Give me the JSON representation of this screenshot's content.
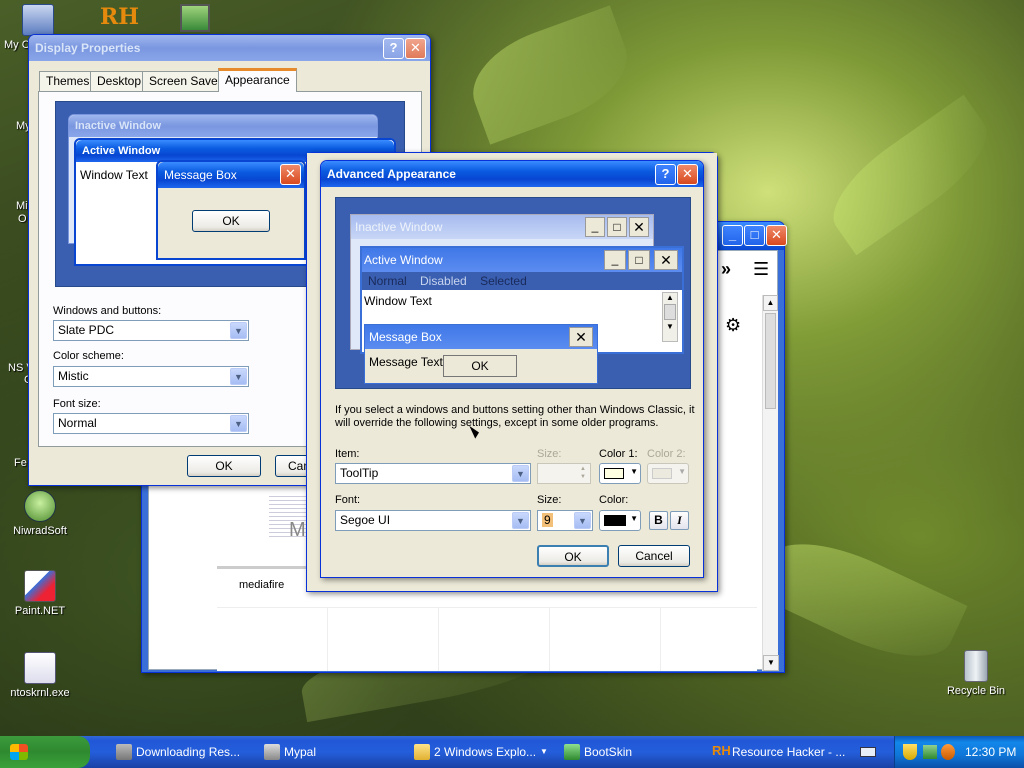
{
  "desktop_icons": [
    {
      "label": "My C",
      "icon": "my-computer-icon"
    },
    {
      "label": "NiwradSoft",
      "icon": "alien-icon"
    },
    {
      "label": "Paint.NET",
      "icon": "paint-icon"
    },
    {
      "label": "ntoskrnl.exe",
      "icon": "exe-icon"
    },
    {
      "label": "Recycle Bin",
      "icon": "recycle-bin-icon"
    }
  ],
  "desktop_partial_labels": [
    "My",
    "Mi",
    "O",
    "NS V",
    "C",
    "Fe"
  ],
  "browser_window": {
    "thumbnail_label": "mediafire",
    "thumbnail_letter": "M",
    "toolbar_chevron": "»",
    "toolbar_menu": "☰"
  },
  "display_properties": {
    "title": "Display Properties",
    "tabs": [
      "Themes",
      "Desktop",
      "Screen Saver",
      "Appearance"
    ],
    "active_tab": "Appearance",
    "preview": {
      "inactive_title": "Inactive Window",
      "active_title": "Active Window",
      "window_text": "Window Text",
      "message_box_title": "Message Box",
      "ok": "OK"
    },
    "windows_buttons_label": "Windows and buttons:",
    "windows_buttons_value": "Slate PDC",
    "color_scheme_label": "Color scheme:",
    "color_scheme_value": "Mistic",
    "font_size_label": "Font size:",
    "font_size_value": "Normal",
    "ok": "OK",
    "cancel": "Cance"
  },
  "advanced": {
    "title": "Advanced Appearance",
    "preview": {
      "inactive_title": "Inactive Window",
      "active_title": "Active Window",
      "menu_items": [
        "Normal",
        "Disabled",
        "Selected"
      ],
      "window_text": "Window Text",
      "message_box_title": "Message Box",
      "message_text": "Message Text",
      "ok": "OK"
    },
    "description": "If you select a windows and buttons setting other than Windows Classic, it will override the following settings, except in some older programs.",
    "item_label": "Item:",
    "item_value": "ToolTip",
    "size_label": "Size:",
    "color1_label": "Color 1:",
    "color2_label": "Color 2:",
    "font_label": "Font:",
    "font_value": "Segoe UI",
    "font_size_label": "Size:",
    "font_size_value": "9",
    "color_label": "Color:",
    "bold": "B",
    "italic": "I",
    "ok": "OK",
    "cancel": "Cancel",
    "color1": "#ffffe1",
    "font_color": "#000000"
  },
  "taskbar": {
    "start": "start",
    "items": [
      {
        "label": "Downloading Res...",
        "icon": "download-icon"
      },
      {
        "label": "Mypal",
        "icon": "mypal-icon"
      },
      {
        "label": "2 Windows Explo...",
        "icon": "folder-icon"
      },
      {
        "label": "BootSkin",
        "icon": "bootskin-icon"
      },
      {
        "label": "Resource Hacker - ...",
        "icon": "rh-icon"
      }
    ],
    "clock": "12:30 PM"
  }
}
